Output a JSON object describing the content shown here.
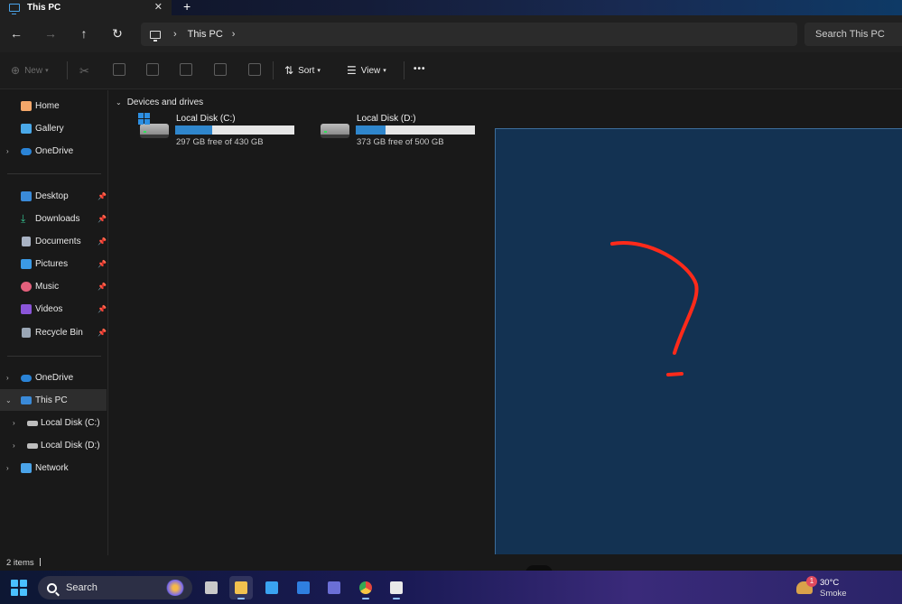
{
  "window": {
    "tab_title": "This PC",
    "close_glyph": "✕",
    "new_tab_glyph": "+"
  },
  "address": {
    "crumb": "This PC",
    "search_placeholder": "Search This PC"
  },
  "commands": {
    "new_label": "New",
    "sort_label": "Sort",
    "view_label": "View",
    "more_label": "•••"
  },
  "sidebar": {
    "quick": [
      {
        "label": "Home",
        "icon": "home-icon"
      },
      {
        "label": "Gallery",
        "icon": "gallery-icon"
      },
      {
        "label": "OneDrive",
        "icon": "onedrive-icon"
      }
    ],
    "pinned": [
      {
        "label": "Desktop",
        "icon": "desktop-icon"
      },
      {
        "label": "Downloads",
        "icon": "downloads-icon"
      },
      {
        "label": "Documents",
        "icon": "documents-icon"
      },
      {
        "label": "Pictures",
        "icon": "pictures-icon"
      },
      {
        "label": "Music",
        "icon": "music-icon"
      },
      {
        "label": "Videos",
        "icon": "videos-icon"
      },
      {
        "label": "Recycle Bin",
        "icon": "recycle-bin-icon"
      }
    ],
    "tree": [
      {
        "label": "OneDrive",
        "icon": "onedrive-icon"
      },
      {
        "label": "This PC",
        "icon": "this-pc-icon"
      },
      {
        "label": "Local Disk (C:)",
        "icon": "drive-icon"
      },
      {
        "label": "Local Disk (D:)",
        "icon": "drive-icon"
      },
      {
        "label": "Network",
        "icon": "network-icon"
      }
    ]
  },
  "content": {
    "group_header": "Devices and drives",
    "drives": [
      {
        "name": "Local Disk (C:)",
        "free_text": "297 GB free of 430 GB",
        "used_fraction": 0.31
      },
      {
        "name": "Local Disk (D:)",
        "free_text": "373 GB free of 500 GB",
        "used_fraction": 0.25
      }
    ]
  },
  "status": {
    "item_count": "2 items"
  },
  "taskbar": {
    "search_label": "Search",
    "weather_temp": "30°C",
    "weather_condition": "Smoke",
    "weather_badge": "1"
  },
  "colors": {
    "accent": "#2f86cc",
    "overlay_bg": "#133252",
    "annotation": "#ff2a1a"
  }
}
